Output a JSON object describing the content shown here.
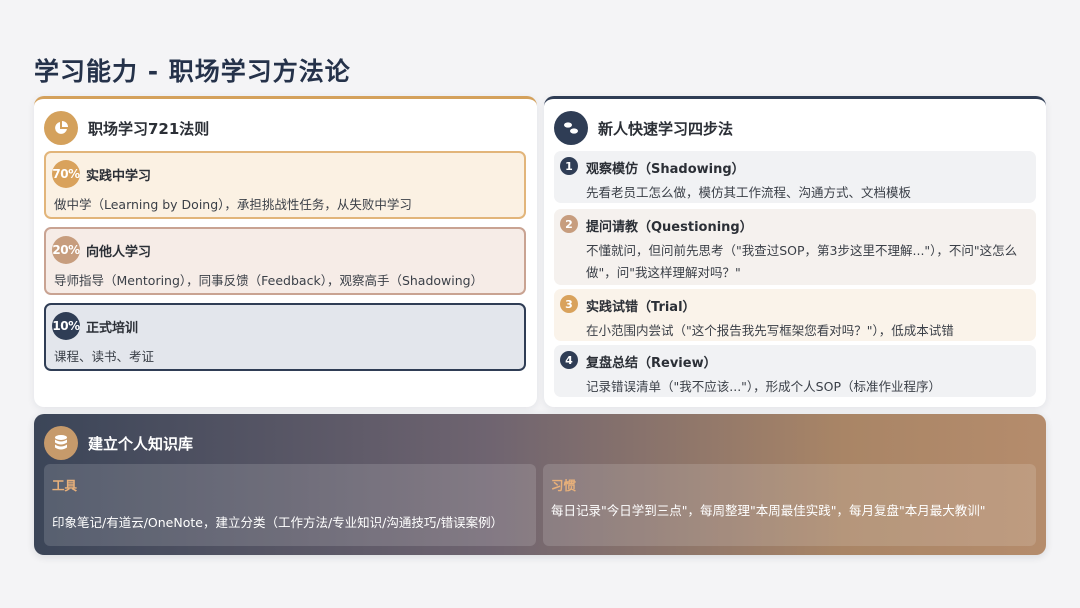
{
  "title": "学习能力 - 职场学习方法论",
  "colors": {
    "gold": "#d4a15c",
    "navy": "#2f3d55",
    "rose": "#c79d7e"
  },
  "left_card": {
    "title": "职场学习721法则",
    "icon": "pie-chart-icon",
    "rules": [
      {
        "percent": "70%",
        "title": "实践中学习",
        "desc": "做中学（Learning by Doing），承担挑战性任务，从失败中学习"
      },
      {
        "percent": "20%",
        "title": "向他人学习",
        "desc": "导师指导（Mentoring），同事反馈（Feedback），观察高手（Shadowing）"
      },
      {
        "percent": "10%",
        "title": "正式培训",
        "desc": "课程、读书、考证"
      }
    ]
  },
  "right_card": {
    "title": "新人快速学习四步法",
    "icon": "footprints-icon",
    "steps": [
      {
        "num": "1",
        "title": "观察模仿（Shadowing）",
        "desc": "先看老员工怎么做，模仿其工作流程、沟通方式、文档模板"
      },
      {
        "num": "2",
        "title": "提问请教（Questioning）",
        "desc": "不懂就问，但问前先思考（\"我查过SOP，第3步这里不理解...\"），不问\"这怎么做\"，问\"我这样理解对吗？\""
      },
      {
        "num": "3",
        "title": "实践试错（Trial）",
        "desc": "在小范围内尝试（\"这个报告我先写框架您看对吗？\"），低成本试错"
      },
      {
        "num": "4",
        "title": "复盘总结（Review）",
        "desc": "记录错误清单（\"我不应该...\"），形成个人SOP（标准作业程序）"
      }
    ]
  },
  "knowledge_base": {
    "title": "建立个人知识库",
    "icon": "database-icon",
    "tools": {
      "label": "工具",
      "text": "印象笔记/有道云/OneNote，建立分类（工作方法/专业知识/沟通技巧/错误案例）"
    },
    "habit": {
      "label": "习惯",
      "text": "每日记录\"今日学到三点\"，每周整理\"本周最佳实践\"，每月复盘\"本月最大教训\""
    }
  }
}
